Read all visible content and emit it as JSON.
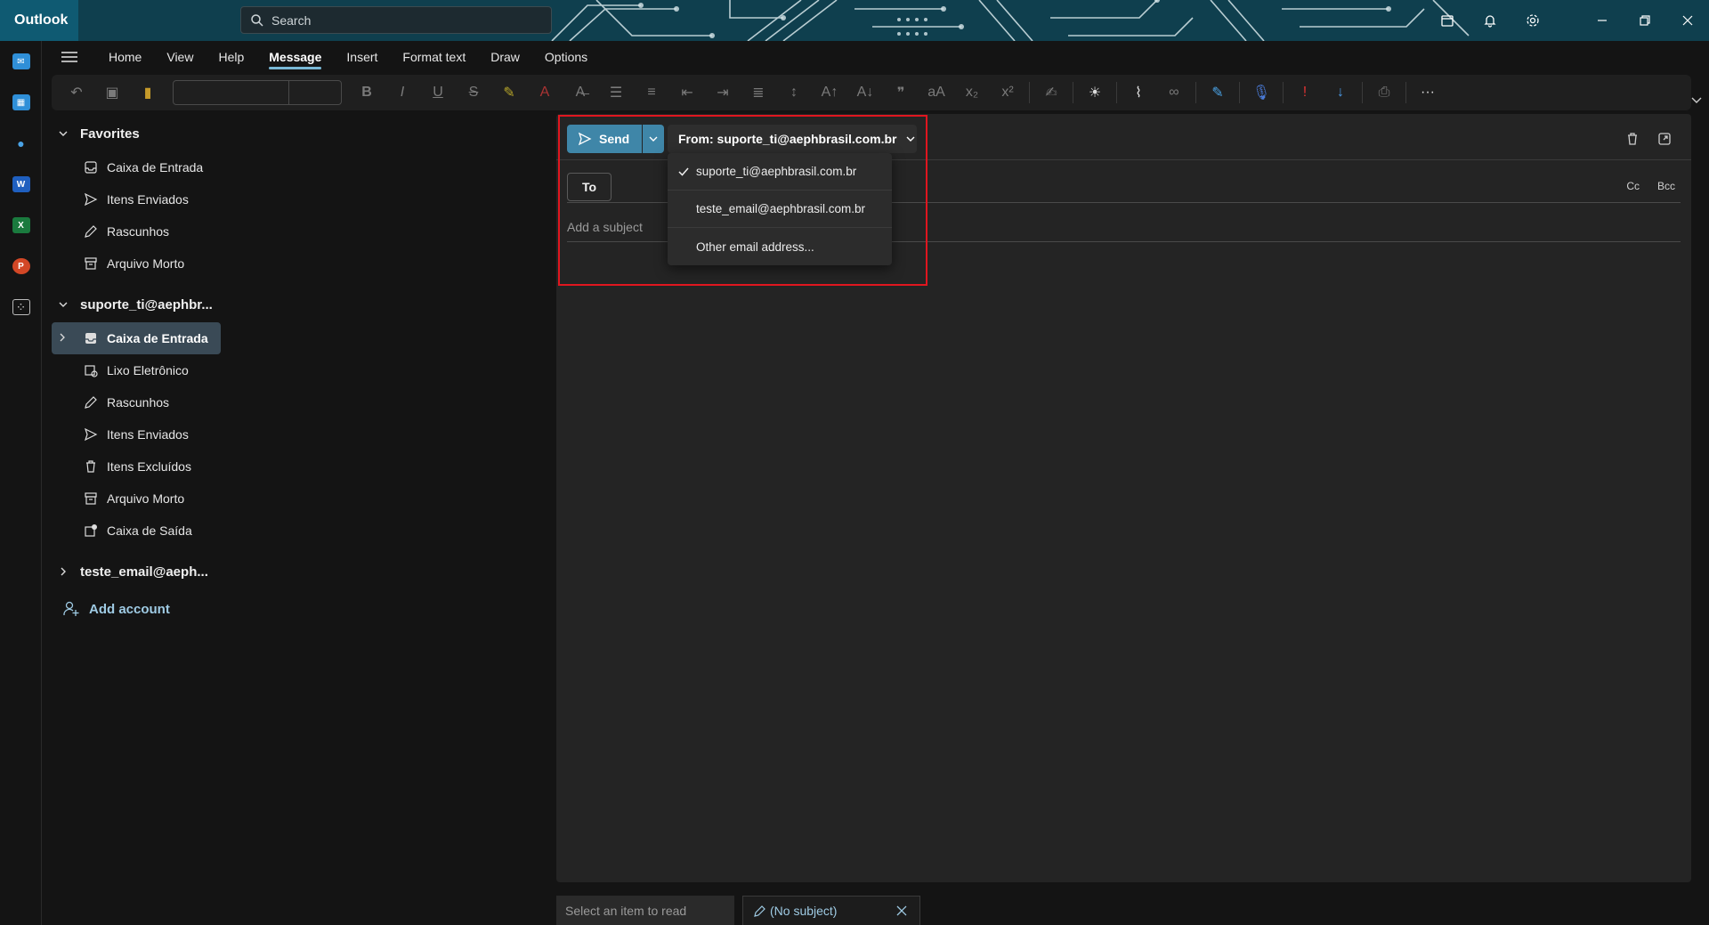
{
  "app": {
    "title": "Outlook"
  },
  "search": {
    "placeholder": "Search"
  },
  "ribbon": {
    "tabs": [
      {
        "label": "Home"
      },
      {
        "label": "View"
      },
      {
        "label": "Help"
      },
      {
        "label": "Message",
        "active": true
      },
      {
        "label": "Insert"
      },
      {
        "label": "Format text"
      },
      {
        "label": "Draw"
      },
      {
        "label": "Options"
      }
    ]
  },
  "folders": {
    "favorites": {
      "label": "Favorites",
      "items": [
        "Caixa de Entrada",
        "Itens Enviados",
        "Rascunhos",
        "Arquivo Morto"
      ]
    },
    "account1": {
      "label": "suporte_ti@aephbr...",
      "items": [
        "Caixa de Entrada",
        "Lixo Eletrônico",
        "Rascunhos",
        "Itens Enviados",
        "Itens Excluídos",
        "Arquivo Morto",
        "Caixa de Saída"
      ],
      "selected_index": 0
    },
    "account2": {
      "label": "teste_email@aeph..."
    },
    "add_account": "Add account"
  },
  "compose": {
    "send_label": "Send",
    "from_label": "From: suporte_ti@aephbrasil.com.br",
    "to_label": "To",
    "cc_label": "Cc",
    "bcc_label": "Bcc",
    "subject_placeholder": "Add a subject"
  },
  "from_dropdown": {
    "options": [
      {
        "label": "suporte_ti@aephbrasil.com.br",
        "checked": true
      },
      {
        "label": "teste_email@aephbrasil.com.br",
        "checked": false
      },
      {
        "label": "Other email address...",
        "checked": false
      }
    ]
  },
  "bottom_tabs": {
    "read_label": "Select an item to read",
    "draft_label": "(No subject)"
  },
  "colors": {
    "accent": "#3f86a8",
    "highlight": "#e0161f",
    "link": "#9fcbe4"
  }
}
